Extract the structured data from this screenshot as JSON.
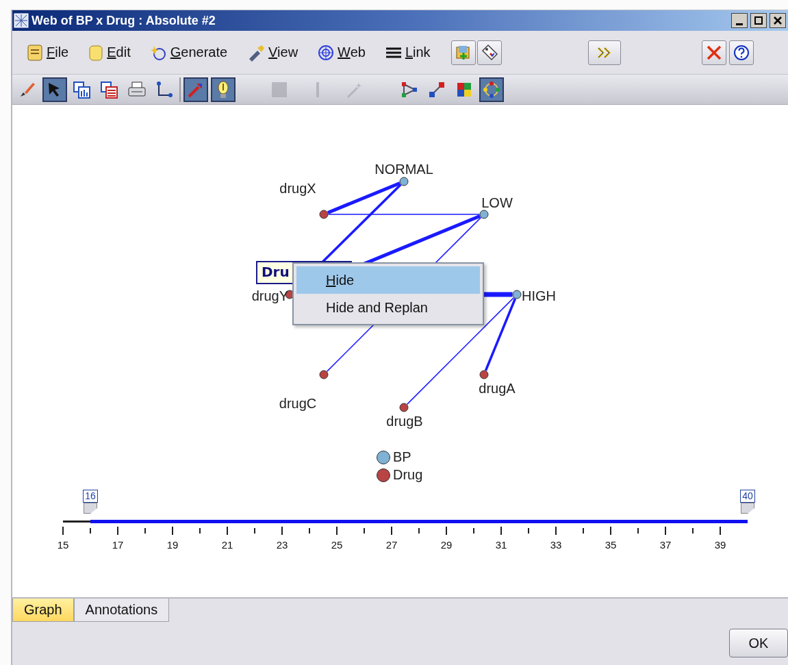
{
  "window": {
    "title": "Web of BP x Drug : Absolute #2"
  },
  "menu_bar": {
    "menus": [
      {
        "label": "File"
      },
      {
        "label": "Edit"
      },
      {
        "label": "Generate"
      },
      {
        "label": "View"
      },
      {
        "label": "Web"
      },
      {
        "label": "Link"
      }
    ]
  },
  "toolbar": {
    "buttons": [
      {
        "pressed": false,
        "disabled": false
      },
      {
        "pressed": true,
        "disabled": false
      },
      {
        "pressed": false,
        "disabled": false
      },
      {
        "pressed": false,
        "disabled": false
      },
      {
        "pressed": false,
        "disabled": false
      },
      {
        "pressed": false,
        "disabled": false
      },
      {
        "pressed": true,
        "disabled": false
      },
      {
        "pressed": true,
        "disabled": false
      },
      {
        "pressed": false,
        "disabled": true
      },
      {
        "pressed": false,
        "disabled": true
      },
      {
        "pressed": false,
        "disabled": true
      },
      {
        "pressed": false,
        "disabled": false
      },
      {
        "pressed": false,
        "disabled": false
      },
      {
        "pressed": false,
        "disabled": false
      },
      {
        "pressed": true,
        "disabled": false
      }
    ]
  },
  "graph": {
    "nodes": [
      {
        "label": "NORMAL",
        "color": "#7fb2d4"
      },
      {
        "label": "LOW",
        "color": "#7fb2d4"
      },
      {
        "label": "HIGH",
        "color": "#7fb2d4"
      },
      {
        "label": "drugX",
        "color": "#b84444"
      },
      {
        "label": "drugY",
        "color": "#b84444"
      },
      {
        "label": "drugC",
        "color": "#b84444"
      },
      {
        "label": "drugB",
        "color": "#b84444"
      },
      {
        "label": "drugA",
        "color": "#b84444"
      }
    ],
    "links": [
      {
        "kind": "heavy"
      },
      {
        "kind": "light"
      },
      {
        "kind": "medium"
      },
      {
        "kind": "heavy"
      },
      {
        "kind": "heaviest"
      },
      {
        "kind": "light"
      },
      {
        "kind": "light"
      },
      {
        "kind": "medium"
      }
    ],
    "selection_label": "Dru",
    "context_menu": [
      {
        "label": "Hide",
        "selected": true,
        "mnemonic": true
      },
      {
        "label": "Hide and Replan",
        "selected": false,
        "mnemonic": false
      }
    ],
    "legend": [
      {
        "label": "BP",
        "color": "#7fb2d4"
      },
      {
        "label": "Drug",
        "color": "#b84444"
      }
    ],
    "range_slider": {
      "thumbs": [
        {
          "label": "16"
        },
        {
          "label": "40"
        }
      ],
      "tick_labels": [
        "15",
        "17",
        "19",
        "21",
        "23",
        "25",
        "27",
        "29",
        "31",
        "33",
        "35",
        "37",
        "39"
      ]
    }
  },
  "tabs": [
    {
      "label": "Graph",
      "selected": true
    },
    {
      "label": "Annotations",
      "selected": false
    }
  ],
  "ok_button": "OK"
}
